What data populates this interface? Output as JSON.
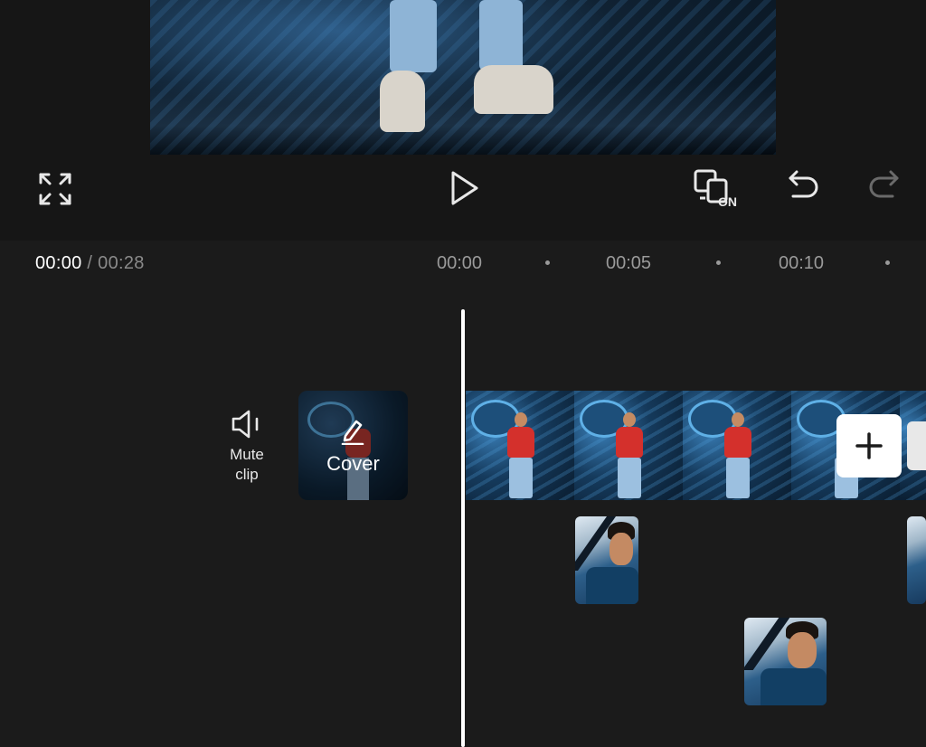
{
  "toolbar": {
    "fullscreen_icon": "expand-icon",
    "play_icon": "play-icon",
    "preview_toggle_icon": "preview-on-icon",
    "preview_toggle_badge": "ON",
    "undo_icon": "undo-icon",
    "redo_icon": "redo-icon"
  },
  "time": {
    "current": "00:00",
    "separator": " / ",
    "total": "00:28"
  },
  "ruler": {
    "ticks": [
      "00:00",
      "00:05",
      "00:10"
    ]
  },
  "track": {
    "mute_label": "Mute\nclip",
    "mute_icon": "speaker-icon",
    "cover_label": "Cover",
    "cover_icon": "edit-icon",
    "add_icon": "plus-icon"
  },
  "colors": {
    "background": "#1b1b1b",
    "playhead": "#ffffff",
    "accent_shirt": "#d4302c"
  }
}
